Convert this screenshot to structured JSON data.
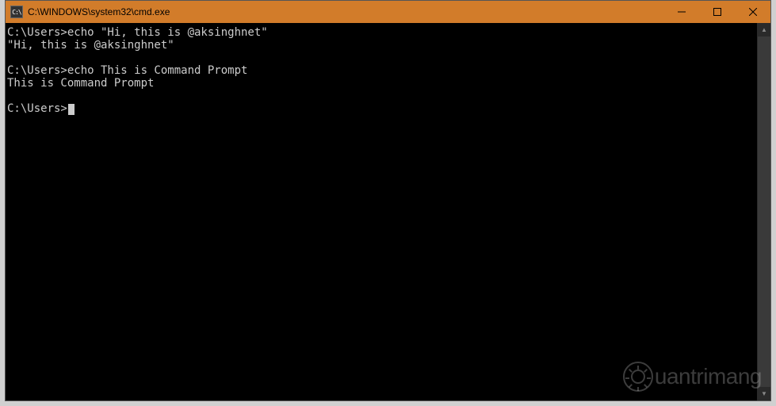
{
  "window": {
    "title": "C:\\WINDOWS\\system32\\cmd.exe",
    "icon_label": "cmd-icon"
  },
  "terminal": {
    "lines": [
      {
        "prompt": "C:\\Users>",
        "cmd": "echo \"Hi, this is @aksinghnet\""
      },
      {
        "output": "\"Hi, this is @aksinghnet\""
      },
      {
        "blank": true
      },
      {
        "prompt": "C:\\Users>",
        "cmd": "echo This is Command Prompt"
      },
      {
        "output": "This is Command Prompt"
      },
      {
        "blank": true
      },
      {
        "prompt": "C:\\Users>",
        "cmd": "",
        "cursor": true
      }
    ]
  },
  "watermark": {
    "text": "uantrimang"
  }
}
